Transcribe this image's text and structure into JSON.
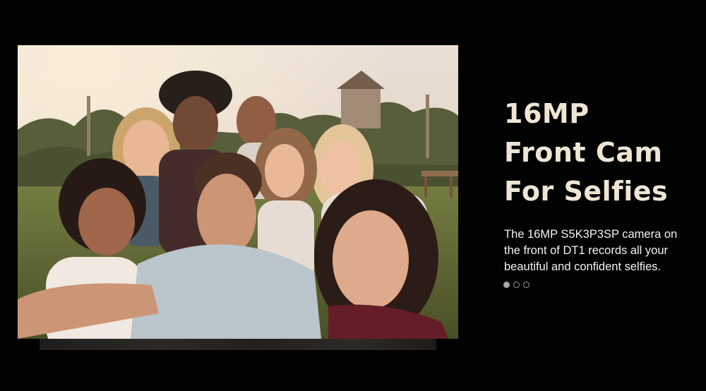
{
  "slide": {
    "headline_lines": [
      "16MP",
      "Front Cam",
      "For Selfies"
    ],
    "description": "The 16MP S5K3P3SP camera on the front of DT1 records all your beautiful and confident selfies."
  },
  "pagination": {
    "total": 3,
    "active_index": 0
  },
  "photo": {
    "subject": "group-selfie-photo"
  },
  "colors": {
    "background": "#020202",
    "headline": "#efe5d4",
    "body_text": "#f2f2f2",
    "dot_active": "#a9a9a9",
    "dot_inactive_border": "#9a9a9a"
  }
}
